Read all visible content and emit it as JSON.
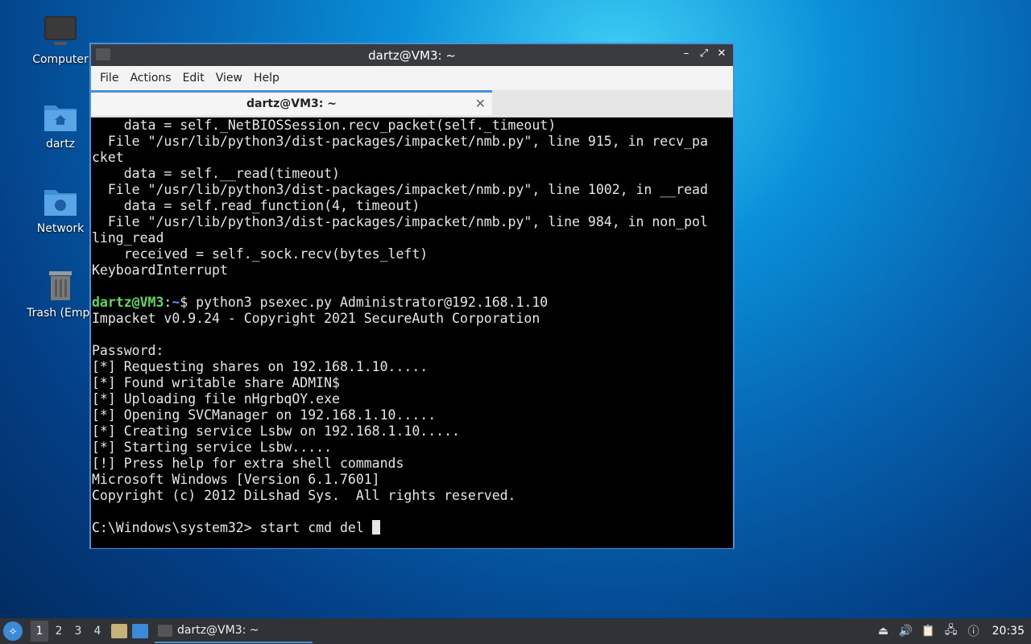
{
  "desktop": {
    "icons": [
      {
        "label": "Computer"
      },
      {
        "label": "dartz"
      },
      {
        "label": "Network"
      },
      {
        "label": "Trash (Empt"
      }
    ]
  },
  "window": {
    "title": "dartz@VM3: ~",
    "controls": {
      "minimize": "–",
      "maximize": "⤢",
      "close": "✕"
    },
    "menu": [
      "File",
      "Actions",
      "Edit",
      "View",
      "Help"
    ],
    "tab": {
      "label": "dartz@VM3: ~",
      "close": "✕"
    }
  },
  "terminal": {
    "lines": [
      "    data = self._NetBIOSSession.recv_packet(self._timeout)",
      "  File \"/usr/lib/python3/dist-packages/impacket/nmb.py\", line 915, in recv_pa",
      "cket",
      "    data = self.__read(timeout)",
      "  File \"/usr/lib/python3/dist-packages/impacket/nmb.py\", line 1002, in __read",
      "    data = self.read_function(4, timeout)",
      "  File \"/usr/lib/python3/dist-packages/impacket/nmb.py\", line 984, in non_pol",
      "ling_read",
      "    received = self._sock.recv(bytes_left)",
      "KeyboardInterrupt",
      ""
    ],
    "prompt_user": "dartz@VM3",
    "prompt_sep": ":",
    "prompt_path": "~",
    "prompt_end": "$ ",
    "command": "python3 psexec.py Administrator@192.168.1.10",
    "output": [
      "Impacket v0.9.24 - Copyright 2021 SecureAuth Corporation",
      "",
      "Password:",
      "[*] Requesting shares on 192.168.1.10.....",
      "[*] Found writable share ADMIN$",
      "[*] Uploading file nHgrbqOY.exe",
      "[*] Opening SVCManager on 192.168.1.10.....",
      "[*] Creating service Lsbw on 192.168.1.10.....",
      "[*] Starting service Lsbw.....",
      "[!] Press help for extra shell commands",
      "Microsoft Windows [Version 6.1.7601]",
      "Copyright (c) 2012 DiLshad Sys.  All rights reserved.",
      ""
    ],
    "current_input": "C:\\Windows\\system32> start cmd del "
  },
  "taskbar": {
    "workspaces": [
      "1",
      "2",
      "3",
      "4"
    ],
    "active_workspace": "1",
    "task_label": "dartz@VM3: ~",
    "clock": "20:35"
  }
}
